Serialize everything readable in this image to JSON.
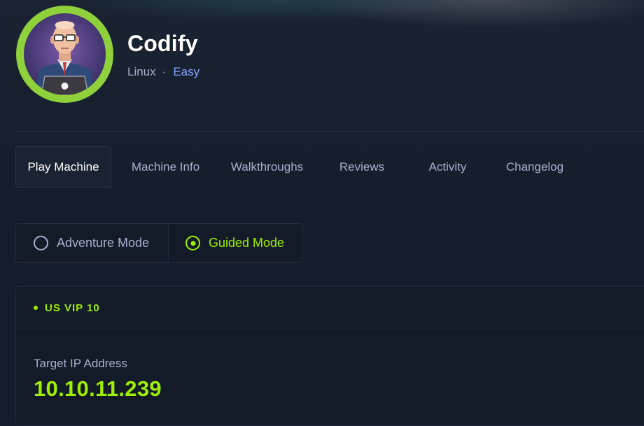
{
  "machine": {
    "name": "Codify",
    "os": "Linux",
    "separator": "·",
    "difficulty": "Easy",
    "avatar_icon": "machine-avatar-icon"
  },
  "tabs": [
    {
      "label": "Play Machine",
      "active": true
    },
    {
      "label": "Machine Info",
      "active": false
    },
    {
      "label": "Walkthroughs",
      "active": false
    },
    {
      "label": "Reviews",
      "active": false
    },
    {
      "label": "Activity",
      "active": false
    },
    {
      "label": "Changelog",
      "active": false
    }
  ],
  "modes": {
    "adventure": {
      "label": "Adventure Mode",
      "selected": false
    },
    "guided": {
      "label": "Guided Mode",
      "selected": true
    }
  },
  "vpn": {
    "server": "US VIP 10",
    "status": "online"
  },
  "target": {
    "label": "Target IP Address",
    "ip": "10.10.11.239"
  },
  "colors": {
    "background": "#141d2b",
    "accent_green": "#9fef00",
    "difficulty_easy": "#86a8ff",
    "muted_text": "#a4b1cd",
    "avatar_ring": "#8ed13b"
  }
}
